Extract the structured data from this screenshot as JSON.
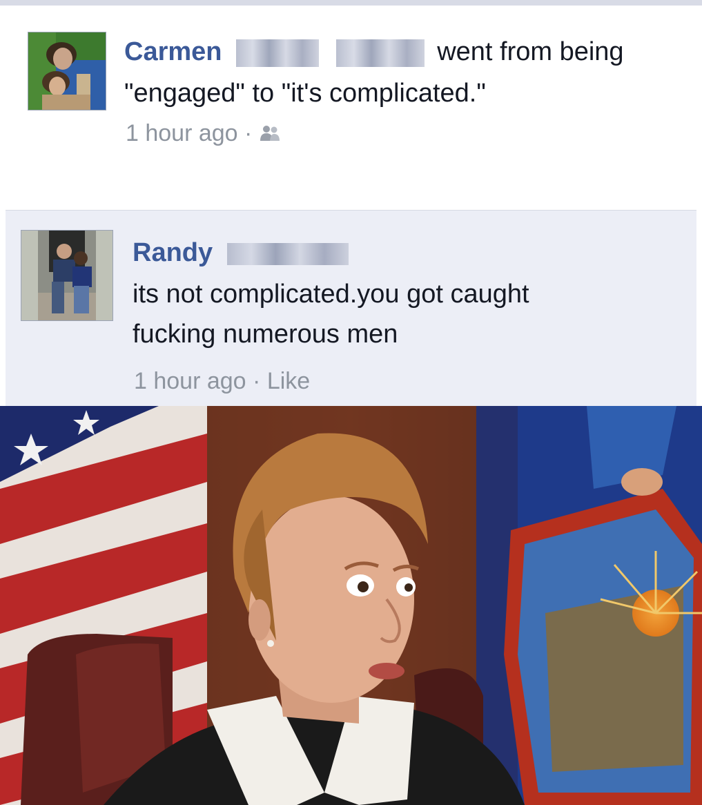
{
  "post": {
    "author": "Carmen",
    "action_text": "went from being",
    "status_change": "\"engaged\" to \"it's complicated.\"",
    "timestamp": "1 hour ago",
    "separator": "·",
    "audience_icon": "friends-icon"
  },
  "comment": {
    "author": "Randy",
    "text_line1": "its not complicated.you got caught",
    "text_line2": "fucking numerous men",
    "timestamp": "1 hour ago",
    "separator": "·",
    "like_label": "Like"
  },
  "colors": {
    "name_blue": "#3b5998",
    "comment_bg": "#eceef6",
    "meta_gray": "#8d949e"
  }
}
